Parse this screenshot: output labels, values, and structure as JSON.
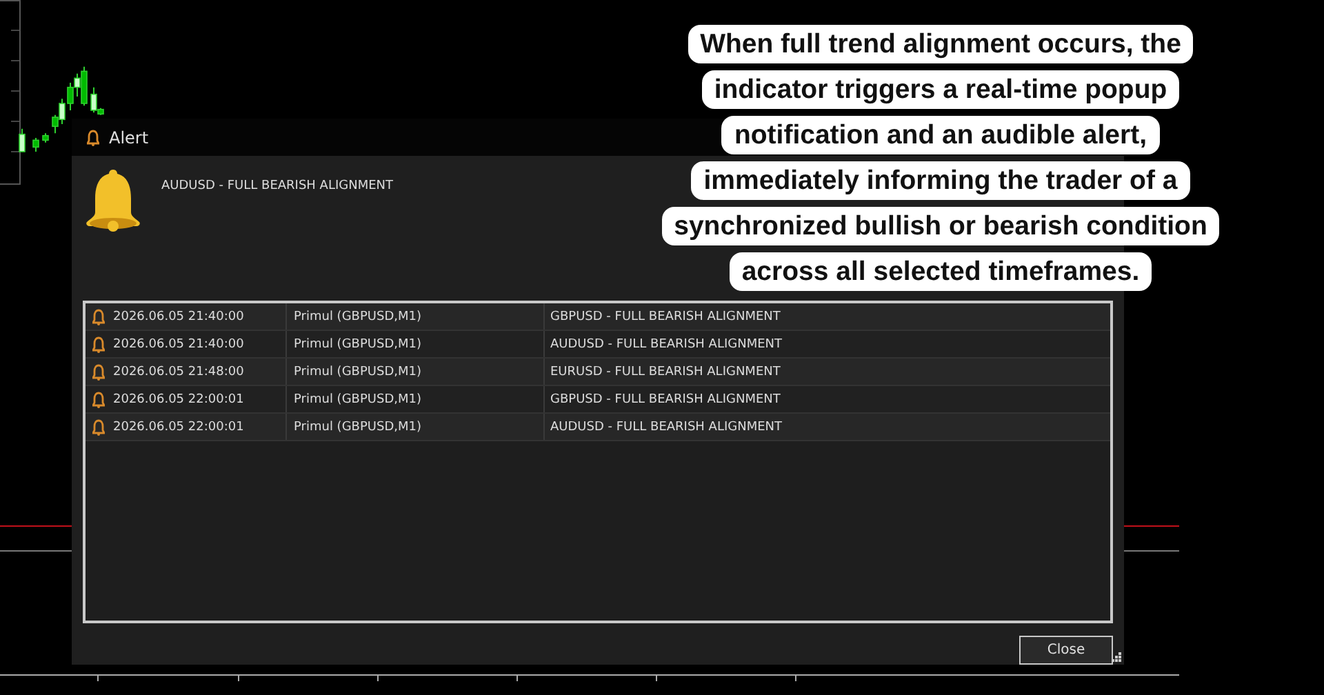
{
  "alert_dialog": {
    "title": "Alert",
    "message": "AUDUSD - FULL BEARISH ALIGNMENT",
    "rows": [
      {
        "time": "2026.06.05 21:40:00",
        "source": "Primul (GBPUSD,M1)",
        "message": "GBPUSD - FULL BEARISH ALIGNMENT"
      },
      {
        "time": "2026.06.05 21:40:00",
        "source": "Primul (GBPUSD,M1)",
        "message": "AUDUSD - FULL BEARISH ALIGNMENT"
      },
      {
        "time": "2026.06.05 21:48:00",
        "source": "Primul (GBPUSD,M1)",
        "message": "EURUSD - FULL BEARISH ALIGNMENT"
      },
      {
        "time": "2026.06.05 22:00:01",
        "source": "Primul (GBPUSD,M1)",
        "message": "GBPUSD - FULL BEARISH ALIGNMENT"
      },
      {
        "time": "2026.06.05 22:00:01",
        "source": "Primul (GBPUSD,M1)",
        "message": "AUDUSD - FULL BEARISH ALIGNMENT"
      }
    ],
    "buttons": [
      "Close"
    ]
  },
  "callout": {
    "text": "When full trend alignment occurs, the indicator triggers a real-time popup notification and an audible alert, immediately informing the trader of a synchronized bullish or bearish condition across all selected timeframes."
  }
}
